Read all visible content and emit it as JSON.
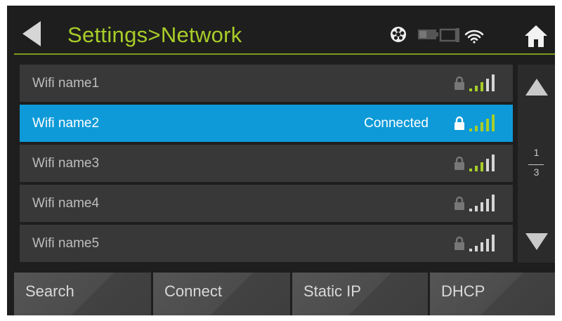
{
  "header": {
    "title": "Settings>Network",
    "icons": [
      "back-arrow-icon",
      "settings-reel-icon",
      "battery-icon",
      "camera-icon",
      "wifi-icon",
      "home-icon"
    ]
  },
  "wifi_list": [
    {
      "name": "Wifi name1",
      "status": "",
      "locked": true,
      "selected": false
    },
    {
      "name": "Wifi name2",
      "status": "Connected",
      "locked": true,
      "selected": true
    },
    {
      "name": "Wifi name3",
      "status": "",
      "locked": true,
      "selected": false
    },
    {
      "name": "Wifi name4",
      "status": "",
      "locked": true,
      "selected": false
    },
    {
      "name": "Wifi name5",
      "status": "",
      "locked": true,
      "selected": false
    }
  ],
  "pagination": {
    "current": "1",
    "total": "3"
  },
  "buttons": {
    "search": "Search",
    "connect": "Connect",
    "static_ip": "Static IP",
    "dhcp": "DHCP"
  },
  "colors": {
    "accent": "#a8cd28",
    "selected_row": "#0e9ad8",
    "row": "#383838",
    "background": "#1e1e1e"
  }
}
